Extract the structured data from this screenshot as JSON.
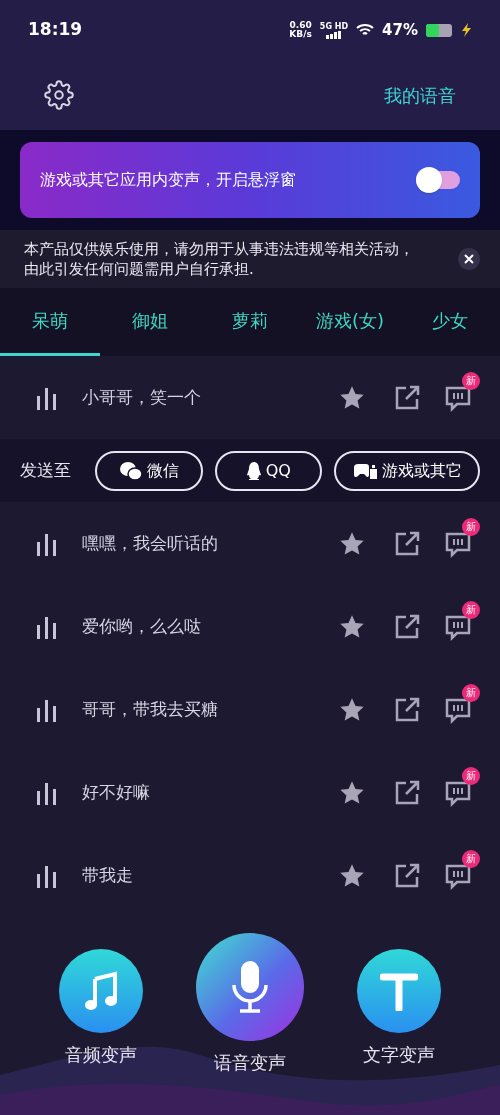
{
  "status_bar": {
    "time": "18:19",
    "speed": "0.60",
    "speed_unit": "KB/s",
    "network": "5G HD",
    "battery": "47%"
  },
  "header": {
    "title": "我的语音"
  },
  "banner": {
    "text": "游戏或其它应用内变声，开启悬浮窗",
    "on": false
  },
  "notice": {
    "text": "本产品仅供娱乐使用，请勿用于从事违法违规等相关活动，由此引发任何问题需用户自行承担."
  },
  "tabs": [
    {
      "label": "呆萌",
      "selected": true
    },
    {
      "label": "御姐",
      "selected": false
    },
    {
      "label": "萝莉",
      "selected": false
    },
    {
      "label": "游戏(女)",
      "selected": false
    },
    {
      "label": "少女",
      "selected": false
    }
  ],
  "rows": [
    {
      "kind": "voice",
      "title": "小哥哥，笑一个",
      "badge": "新"
    },
    {
      "kind": "share",
      "label": "发送至",
      "targets": [
        {
          "kind": "wechat",
          "label": "微信"
        },
        {
          "kind": "qq",
          "label": "QQ"
        },
        {
          "kind": "game",
          "label": "游戏或其它"
        }
      ]
    },
    {
      "kind": "voice",
      "title": "嘿嘿，我会听话的",
      "badge": "新"
    },
    {
      "kind": "voice",
      "title": "爱你哟，么么哒",
      "badge": "新"
    },
    {
      "kind": "voice",
      "title": "哥哥，带我去买糖",
      "badge": "新"
    },
    {
      "kind": "voice",
      "title": "好不好嘛",
      "badge": "新"
    },
    {
      "kind": "voice",
      "title": "带我走",
      "badge": "新"
    }
  ],
  "bottom_nav": [
    {
      "kind": "audio",
      "label": "音频变声"
    },
    {
      "kind": "voice",
      "label": "语音变声"
    },
    {
      "kind": "text",
      "label": "文字变声"
    }
  ]
}
